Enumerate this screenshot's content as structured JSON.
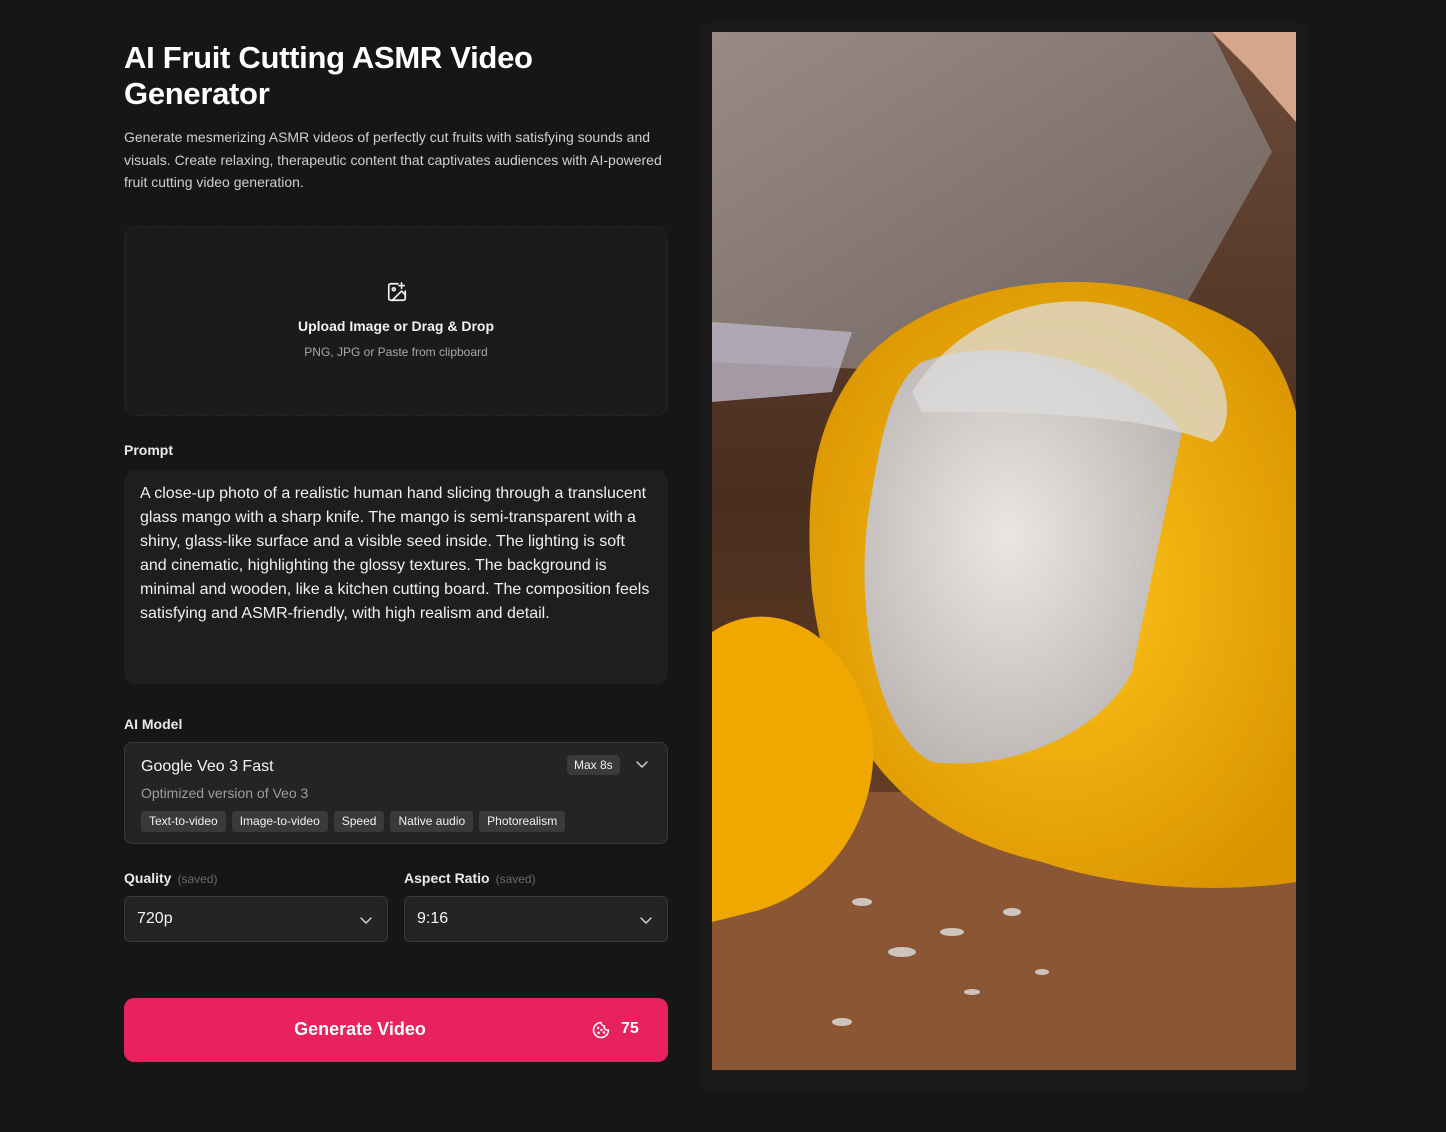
{
  "header": {
    "title": "AI Fruit Cutting ASMR Video Generator",
    "description": "Generate mesmerizing ASMR videos of perfectly cut fruits with satisfying sounds and visuals. Create relaxing, therapeutic content that captivates audiences with AI-powered fruit cutting video generation."
  },
  "upload": {
    "icon": "image-plus-icon",
    "title": "Upload Image or Drag & Drop",
    "subtitle": "PNG, JPG or Paste from clipboard"
  },
  "prompt": {
    "label": "Prompt",
    "value": "A close-up photo of a realistic human hand slicing through a translucent glass mango with a sharp knife. The mango is semi-transparent with a shiny, glass-like surface and a visible seed inside. The lighting is soft and cinematic, highlighting the glossy textures. The background is minimal and wooden, like a kitchen cutting board. The composition feels satisfying and ASMR-friendly, with high realism and detail."
  },
  "model": {
    "label": "AI Model",
    "name": "Google Veo 3 Fast",
    "subtitle": "Optimized version of Veo 3",
    "badge": "Max 8s",
    "tags": [
      "Text-to-video",
      "Image-to-video",
      "Speed",
      "Native audio",
      "Photorealism"
    ]
  },
  "quality": {
    "label": "Quality",
    "saved": "(saved)",
    "value": "720p"
  },
  "aspect_ratio": {
    "label": "Aspect Ratio",
    "saved": "(saved)",
    "value": "9:16"
  },
  "generate": {
    "label": "Generate Video",
    "credits": "75",
    "icon": "cookie-icon"
  },
  "colors": {
    "accent": "#e8225f",
    "background": "#161616",
    "panel": "#242424"
  }
}
